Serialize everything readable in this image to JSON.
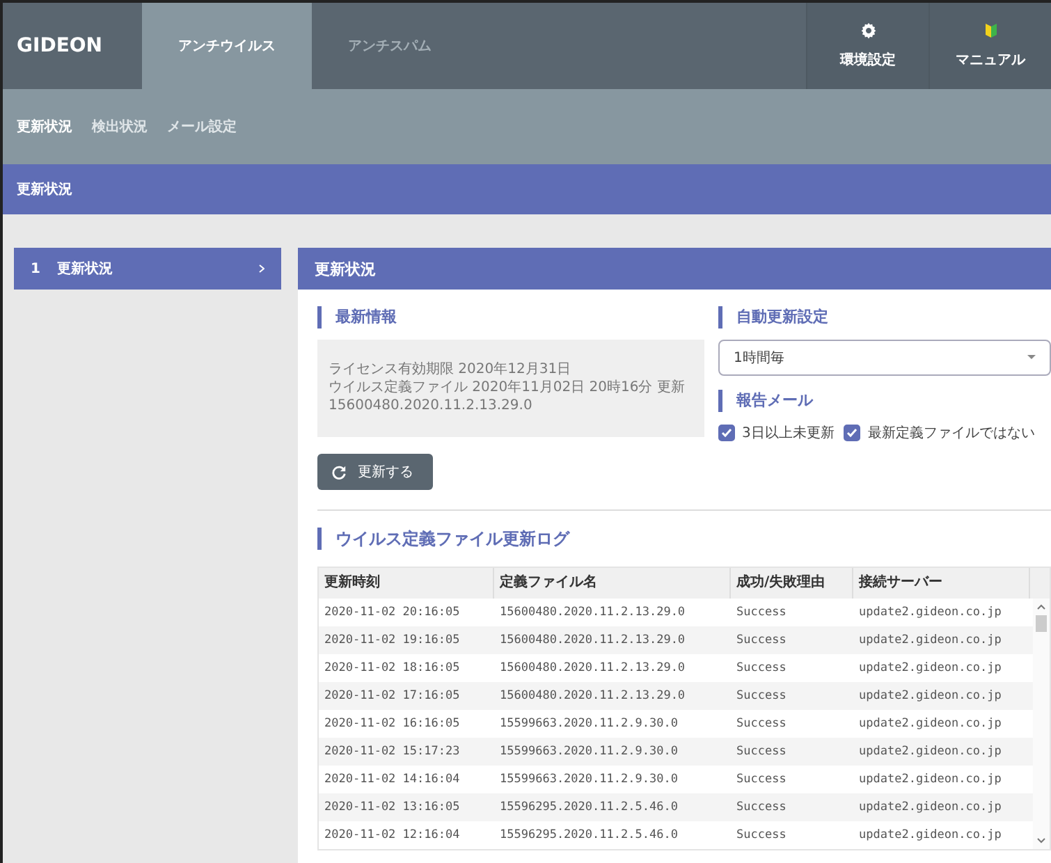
{
  "nav": {
    "logo": "GIDEON",
    "tabs": [
      {
        "label": "アンチウイルス",
        "selected": true
      },
      {
        "label": "アンチスパム",
        "selected": false
      }
    ],
    "actions": [
      {
        "kind": "gear",
        "label": "環境設定"
      },
      {
        "kind": "leaf",
        "label": "マニュアル"
      }
    ]
  },
  "subtabs": [
    {
      "label": "更新状況",
      "selected": true
    },
    {
      "label": "検出状況",
      "selected": false
    },
    {
      "label": "メール設定",
      "selected": false
    }
  ],
  "breadcrumb": "更新状況",
  "sidebar": {
    "items": [
      {
        "number": "1",
        "label": "更新状況",
        "selected": true
      }
    ]
  },
  "panel": {
    "title": "更新状況",
    "latest": {
      "heading": "最新情報",
      "lines": [
        "ライセンス有効期限 2020年12月31日",
        "ウイルス定義ファイル 2020年11月02日 20時16分 更新",
        "15600480.2020.11.2.13.29.0"
      ]
    },
    "update_button": "更新する",
    "auto_update": {
      "heading": "自動更新設定",
      "value": "1時間毎"
    },
    "report_mail": {
      "heading": "報告メール",
      "options": [
        {
          "label": "3日以上未更新",
          "checked": true
        },
        {
          "label": "最新定義ファイルではない",
          "checked": true
        }
      ]
    },
    "log": {
      "heading": "ウイルス定義ファイル更新ログ",
      "columns": [
        "更新時刻",
        "定義ファイル名",
        "成功/失敗理由",
        "接続サーバー"
      ],
      "rows": [
        [
          "2020-11-02 20:16:05",
          "15600480.2020.11.2.13.29.0",
          "Success",
          "update2.gideon.co.jp"
        ],
        [
          "2020-11-02 19:16:05",
          "15600480.2020.11.2.13.29.0",
          "Success",
          "update2.gideon.co.jp"
        ],
        [
          "2020-11-02 18:16:05",
          "15600480.2020.11.2.13.29.0",
          "Success",
          "update2.gideon.co.jp"
        ],
        [
          "2020-11-02 17:16:05",
          "15600480.2020.11.2.13.29.0",
          "Success",
          "update2.gideon.co.jp"
        ],
        [
          "2020-11-02 16:16:05",
          "15599663.2020.11.2.9.30.0",
          "Success",
          "update2.gideon.co.jp"
        ],
        [
          "2020-11-02 15:17:23",
          "15599663.2020.11.2.9.30.0",
          "Success",
          "update2.gideon.co.jp"
        ],
        [
          "2020-11-02 14:16:04",
          "15599663.2020.11.2.9.30.0",
          "Success",
          "update2.gideon.co.jp"
        ],
        [
          "2020-11-02 13:16:05",
          "15596295.2020.11.2.5.46.0",
          "Success",
          "update2.gideon.co.jp"
        ],
        [
          "2020-11-02 12:16:04",
          "15596295.2020.11.2.5.46.0",
          "Success",
          "update2.gideon.co.jp"
        ]
      ]
    }
  }
}
